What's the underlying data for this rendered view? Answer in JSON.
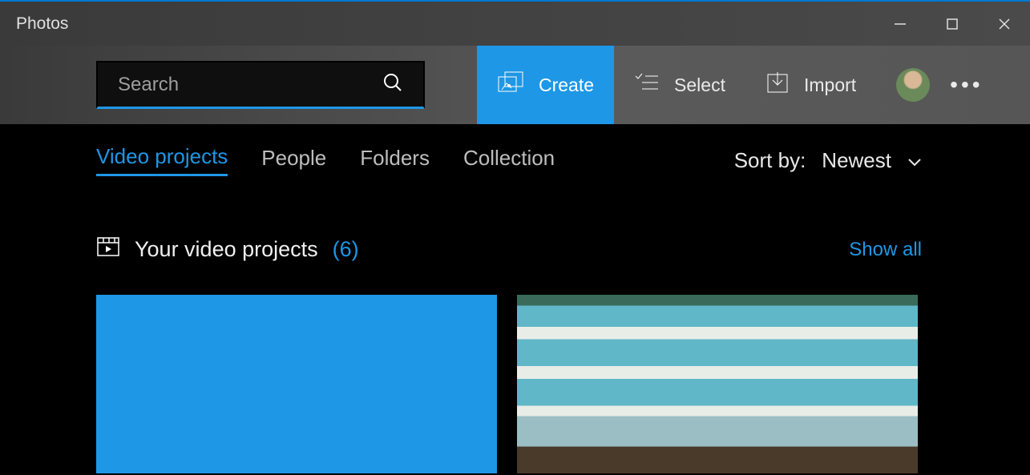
{
  "app": {
    "title": "Photos"
  },
  "search": {
    "placeholder": "Search"
  },
  "toolbar": {
    "create": "Create",
    "select": "Select",
    "import": "Import"
  },
  "tabs": {
    "video_projects": "Video projects",
    "people": "People",
    "folders": "Folders",
    "collection": "Collection"
  },
  "sort": {
    "label": "Sort by:",
    "value": "Newest"
  },
  "section": {
    "title": "Your video projects",
    "count": "(6)",
    "show_all": "Show all"
  }
}
